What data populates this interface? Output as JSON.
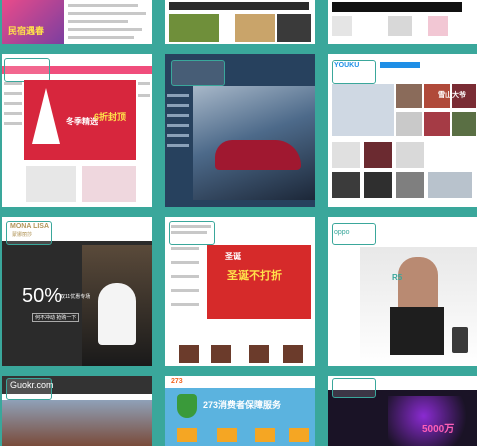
{
  "tiles": [
    {
      "key": "t1",
      "label": "民宿遇春"
    },
    {
      "key": "t4",
      "label": "冬季精选",
      "badge": "6折封顶"
    },
    {
      "key": "t6",
      "label": "YOUKU",
      "side_text": "雪山大爷"
    },
    {
      "key": "t7",
      "label": "MONA LISA",
      "sub": "蒙娜丽莎",
      "promo_pct": "50%",
      "promo_line": "双11优惠专场",
      "promo_btn": "何不冲动 抢购一下"
    },
    {
      "key": "t8",
      "label": "圣诞不打折",
      "side": "圣诞"
    },
    {
      "key": "t9",
      "label": "oppo",
      "product": "R5"
    },
    {
      "key": "t10",
      "label": "Guokr.com"
    },
    {
      "key": "t11",
      "label": "273消费者保障服务"
    },
    {
      "key": "t12",
      "label": "5000万"
    }
  ]
}
